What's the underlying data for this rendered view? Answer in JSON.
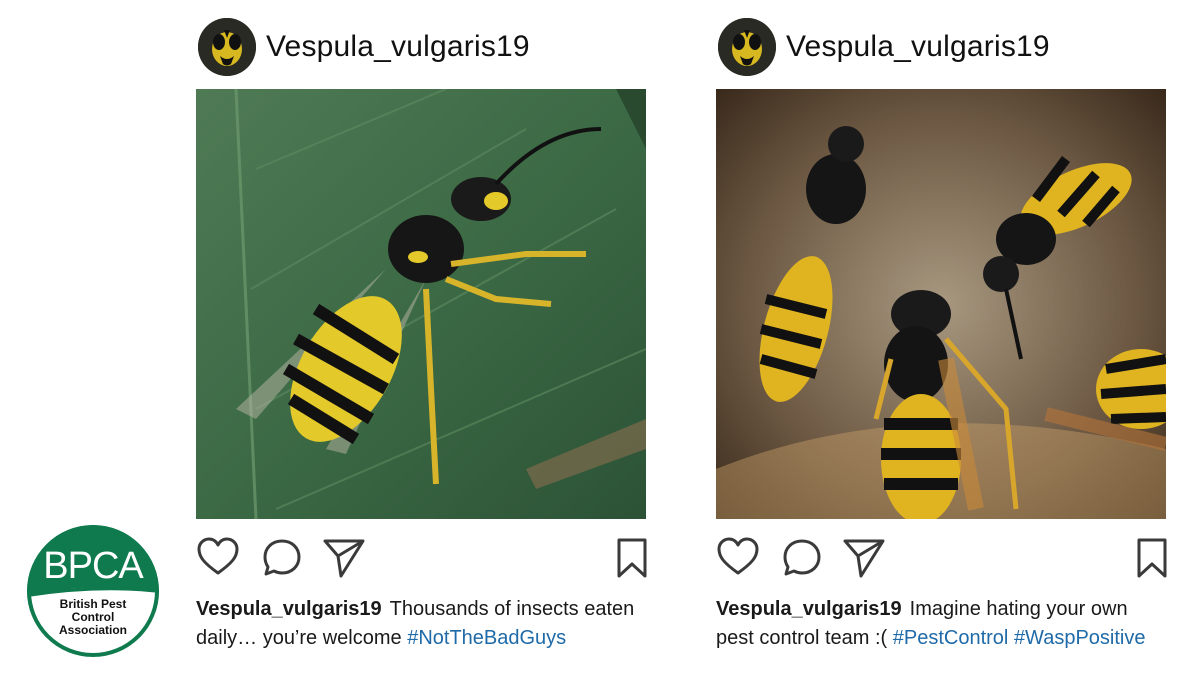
{
  "posts": [
    {
      "username": "Vespula_vulgaris19",
      "photo_subject": "wasp resting on a green leaf",
      "caption_user": "Vespula_vulgaris19",
      "caption_text": "Thousands of insects eaten daily… you’re welcome ",
      "hashtags": [
        "#NotTheBadGuys"
      ]
    },
    {
      "username": "Vespula_vulgaris19",
      "photo_subject": "wasps on a papery nest",
      "caption_user": "Vespula_vulgaris19",
      "caption_text": "Imagine hating your own pest control team :( ",
      "hashtags": [
        "#PestControl",
        "#WaspPositive"
      ]
    }
  ],
  "icons": [
    "heart-icon",
    "comment-icon",
    "share-icon",
    "bookmark-icon"
  ],
  "logo": {
    "title": "BPCA",
    "subtitle": "British Pest Control Association",
    "color": "#0e7a4d"
  },
  "colors": {
    "hashtag": "#1f6aa8",
    "text": "#1a1a1a"
  }
}
